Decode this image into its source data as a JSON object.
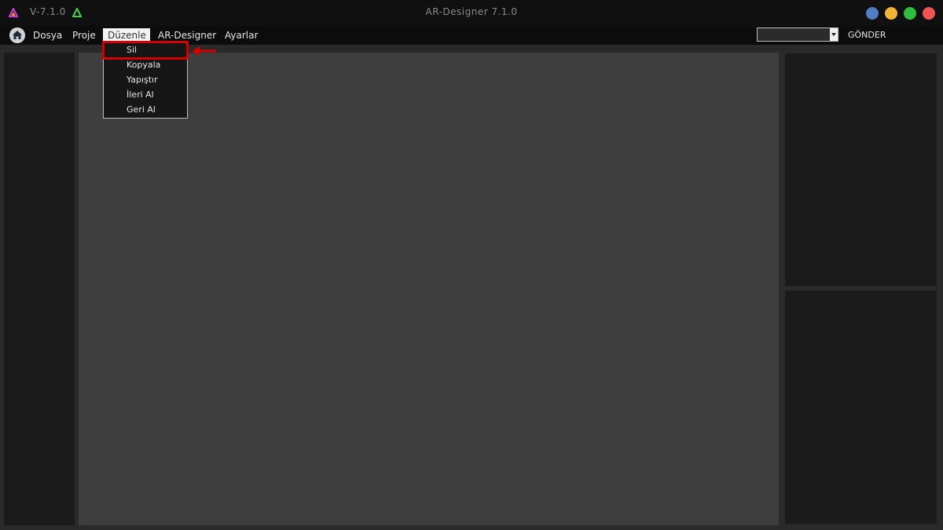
{
  "titlebar": {
    "version": "V-7.1.0",
    "title": "AR-Designer 7.1.0",
    "colors": {
      "minimize": "#4f7ec4",
      "maximize": "#f0b436",
      "fullscreen": "#2fbf3f",
      "close": "#ee5555"
    }
  },
  "menubar": {
    "home_icon": "home-icon",
    "items": [
      "Dosya",
      "Proje",
      "Düzenle",
      "AR-Designer",
      "Ayarlar"
    ],
    "active_item": "Düzenle",
    "select_value": "",
    "send_label": "GÖNDER"
  },
  "edit_menu": {
    "items": [
      "Sil",
      "Kopyala",
      "Yapıştır",
      "İleri Al",
      "Geri Al"
    ],
    "highlighted": "Sil",
    "highlight_color": "#d40000"
  }
}
